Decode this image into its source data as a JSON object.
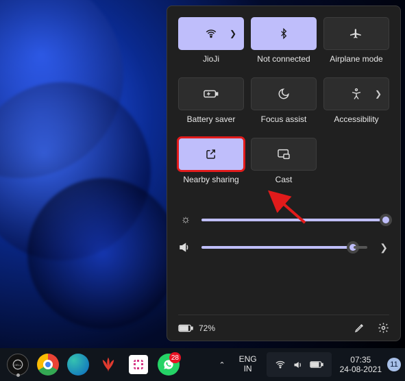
{
  "quick": {
    "tiles": [
      {
        "label": "JioJi",
        "active": true,
        "has_chevron": true
      },
      {
        "label": "Not connected",
        "active": true,
        "has_chevron": false
      },
      {
        "label": "Airplane mode",
        "active": false,
        "has_chevron": false
      },
      {
        "label": "Battery saver",
        "active": false,
        "has_chevron": false
      },
      {
        "label": "Focus assist",
        "active": false,
        "has_chevron": false
      },
      {
        "label": "Accessibility",
        "active": false,
        "has_chevron": true
      },
      {
        "label": "Nearby sharing",
        "active": true,
        "has_chevron": false,
        "highlight": true
      },
      {
        "label": "Cast",
        "active": false,
        "has_chevron": false
      }
    ],
    "brightness_pct": 98,
    "volume_pct": 92,
    "battery_text": "72%"
  },
  "taskbar": {
    "lang_top": "ENG",
    "lang_bottom": "IN",
    "time": "07:35",
    "date": "24-08-2021",
    "notif_count": "11",
    "whatsapp_badge": "28"
  }
}
